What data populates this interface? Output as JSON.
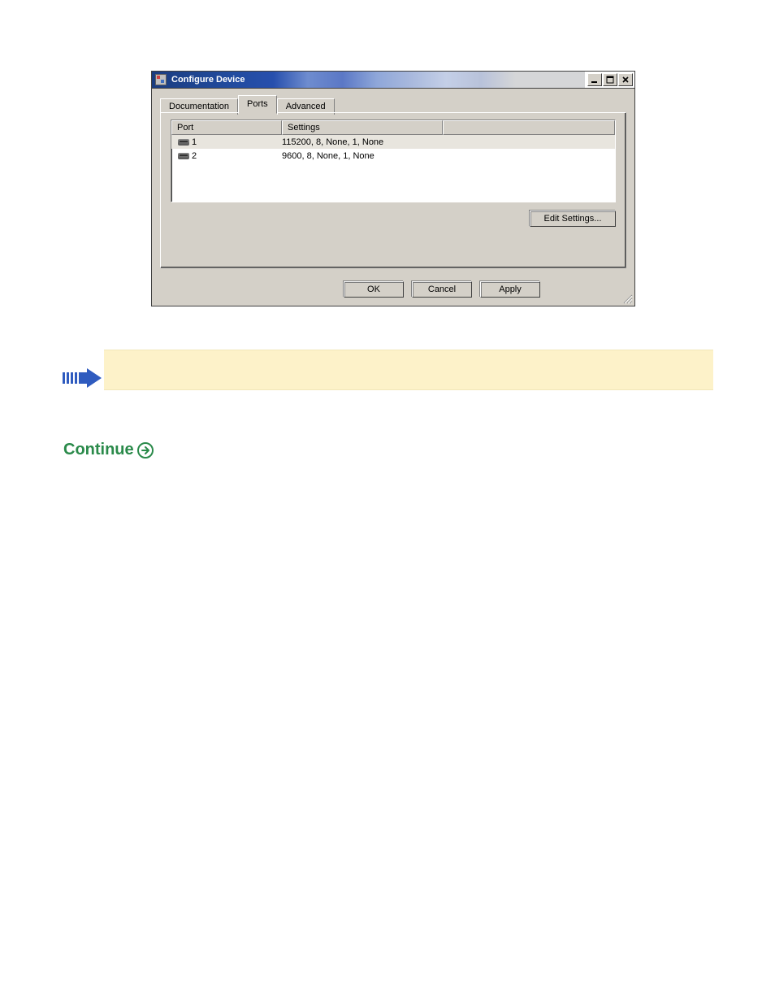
{
  "dialog": {
    "title": "Configure Device",
    "tabs": [
      {
        "label": "Documentation",
        "active": false
      },
      {
        "label": "Ports",
        "active": true
      },
      {
        "label": "Advanced",
        "active": false
      }
    ],
    "list": {
      "columns": {
        "port": "Port",
        "settings": "Settings"
      },
      "rows": [
        {
          "port": "1",
          "settings": "115200, 8, None, 1, None",
          "selected": true
        },
        {
          "port": "2",
          "settings": "9600, 8, None, 1, None",
          "selected": false
        }
      ]
    },
    "buttons": {
      "edit": "Edit Settings...",
      "ok": "OK",
      "cancel": "Cancel",
      "apply": "Apply"
    }
  },
  "continue_label": "Continue"
}
